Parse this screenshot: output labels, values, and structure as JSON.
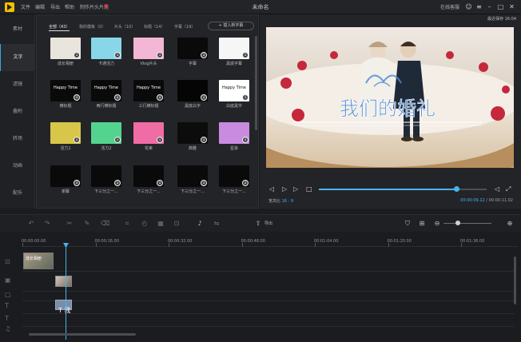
{
  "app": {
    "title": "未命名",
    "menu": [
      "文件",
      "编辑",
      "导出",
      "帮助",
      "制作片头片尾"
    ],
    "titlebar_right": "在线客服"
  },
  "left_tabs": [
    "素材",
    "文字",
    "滤镜",
    "叠附",
    "转场",
    "动画",
    "配乐"
  ],
  "library": {
    "categories": [
      "全部（43）",
      "我的模板（0）",
      "片头（10）",
      "标题（14）",
      "字幕（19）"
    ],
    "add_button": "插入新字幕",
    "tiles": [
      {
        "label": "成长相册",
        "text": "",
        "color": "#e9e4dc"
      },
      {
        "label": "卡通活力",
        "text": "",
        "color": "#87d7e8"
      },
      {
        "label": "Vlog片头",
        "text": "",
        "color": "#f3b6d4"
      },
      {
        "label": "字幕",
        "text": "",
        "color": "#0a0a0a"
      },
      {
        "label": "黑底字幕",
        "text": "",
        "color": "#f6f6f6"
      },
      {
        "label": "横标题",
        "text": "Happy Time",
        "color": "#0a0a0a"
      },
      {
        "label": "两行横标题",
        "text": "Happy Time",
        "color": "#0a0a0a"
      },
      {
        "label": "三行横标题",
        "text": "Happy Time",
        "color": "#0a0a0a"
      },
      {
        "label": "黑底白字",
        "text": "",
        "color": "#050505"
      },
      {
        "label": "白底黑字",
        "text": "Happy Time",
        "color": "#ffffff"
      },
      {
        "label": "活力1",
        "text": "",
        "color": "#d8c64a"
      },
      {
        "label": "活力2",
        "text": "",
        "color": "#54d38f"
      },
      {
        "label": "花束",
        "text": "",
        "color": "#f06ca4"
      },
      {
        "label": "典雅",
        "text": "",
        "color": "#0c0c0c"
      },
      {
        "label": "星染",
        "text": "",
        "color": "#c88be0"
      },
      {
        "label": "谢幕",
        "text": "",
        "color": "#0a0a0a"
      },
      {
        "label": "下三分之一...",
        "text": "",
        "color": "#0a0a0a"
      },
      {
        "label": "下三分之一...",
        "text": "",
        "color": "#0a0a0a"
      },
      {
        "label": "下三分之一...",
        "text": "",
        "color": "#0a0a0a"
      },
      {
        "label": "下三分之一...",
        "text": "",
        "color": "#0a0a0a"
      }
    ]
  },
  "preview": {
    "saved_text": "最近保存 16:04",
    "caption": "我们的婚礼",
    "ratio_label": "宽高比",
    "ratio_value": "16 : 9",
    "time_current": "00:00:09.12",
    "time_total": "00:00:11.02",
    "progress": 0.82
  },
  "toolbar": {
    "export_label": "导出",
    "zoom": 0.3
  },
  "timeline": {
    "ticks": [
      "00:00:00.00",
      "00:00:16.00",
      "00:00:32.00",
      "00:00:48.00",
      "00:01:04.00",
      "00:01:20.00",
      "00:01:36.00"
    ],
    "clip1_label": "成长相册",
    "clip3_label": "T 我"
  }
}
